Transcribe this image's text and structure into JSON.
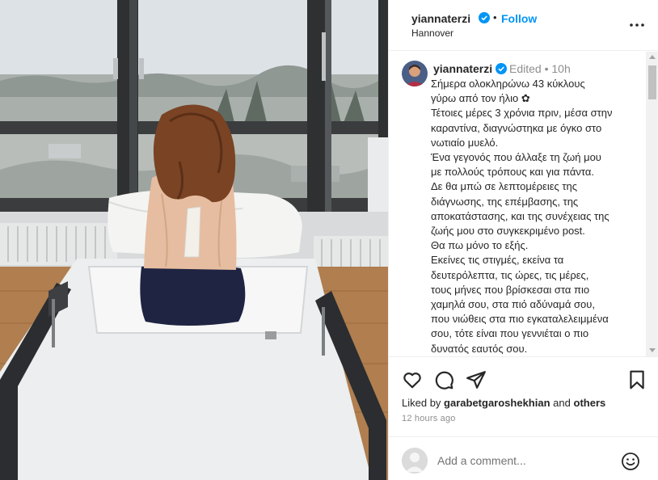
{
  "post_header": {
    "username": "yiannaterzi",
    "separator": "•",
    "follow_label": "Follow",
    "location": "Hannover"
  },
  "caption": {
    "username": "yiannaterzi",
    "meta": "Edited • 10h",
    "lines": [
      "Σήμερα ολοκληρώνω 43 κύκλους",
      "γύρω από τον ήλιο ✿",
      "Τέτοιες μέρες 3 χρόνια πριν, μέσα στην",
      "καραντίνα, διαγνώστηκα με όγκο στο",
      "νωτιαίο μυελό.",
      "Ένα γεγονός που άλλαξε τη ζωή μου",
      "με πολλούς τρόπους και για πάντα.",
      "Δε θα μπώ σε λεπτομέρειες της",
      "διάγνωσης, της επέμβασης, της",
      "αποκατάστασης, και της συνέχειας της",
      "ζωής μου στο συγκεκριμένο post.",
      "Θα πω μόνο το εξής.",
      "Εκείνες τις στιγμές, εκείνα τα",
      "δευτερόλεπτα, τις ώρες, τις μέρες,",
      "τους μήνες που βρίσκεσαι στα πιο",
      "χαμηλά σου, στα πιό αδύναμά σου,",
      "που νιώθεις στα πιο εγκαταλελειμμένα",
      "σου, τότε είναι που γεννιέται ο πιο",
      "δυνατός εαυτός σου."
    ]
  },
  "likes": {
    "prefix": "Liked by",
    "user": "garabetgaroshekhian",
    "joiner": "and",
    "others": "others"
  },
  "timestamp": "12 hours ago",
  "comment_box": {
    "placeholder": "Add a comment..."
  },
  "icons": {
    "verified": "verified-badge-icon",
    "more": "more-options-icon",
    "like": "heart-icon",
    "comment": "comment-bubble-icon",
    "share": "share-paper-plane-icon",
    "save": "bookmark-icon",
    "emoji": "emoji-smiley-icon"
  },
  "colors": {
    "accent": "#0095f6",
    "verified": "#0095f6",
    "text": "#262626",
    "muted": "#8e8e8e",
    "divider": "#efefef"
  }
}
